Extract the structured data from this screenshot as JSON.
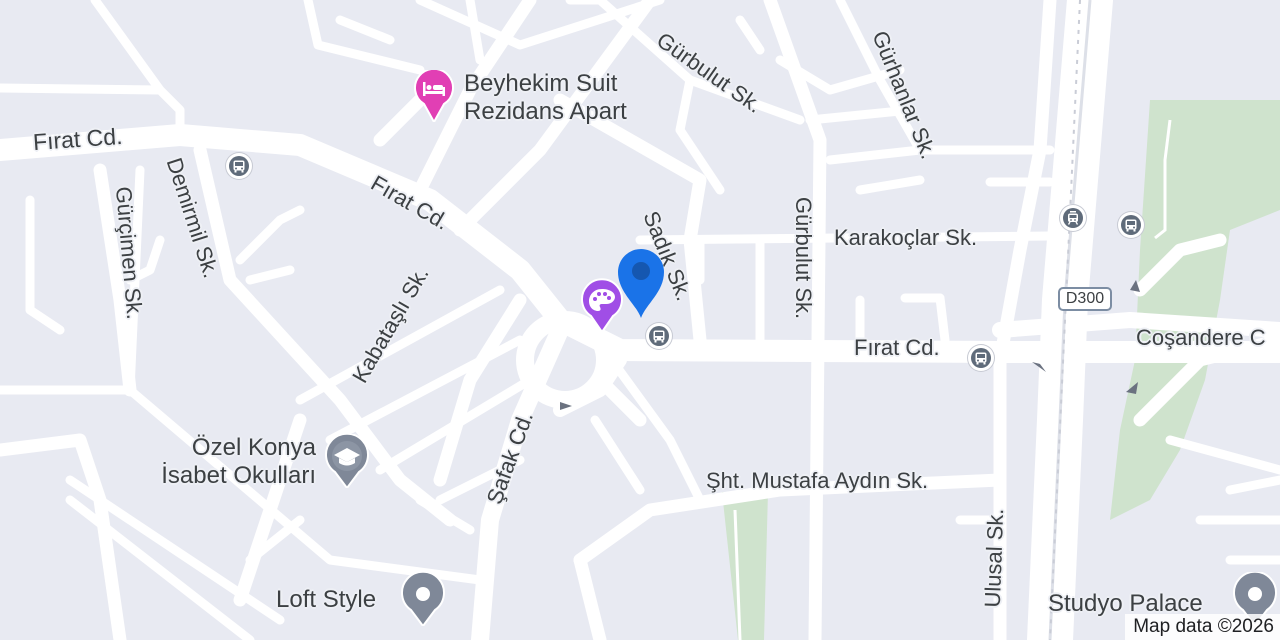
{
  "streets": {
    "firat_cd_west": "Fırat Cd.",
    "firat_cd_middle": "Fırat Cd.",
    "firat_cd_east": "Fırat Cd.",
    "gurbulut_sk_top": "Gürbulut Sk.",
    "gurbulut_sk_mid": "Gürbulut Sk.",
    "gurhanlar_sk": "Gürhanlar Sk.",
    "karakoclar_sk": "Karakoçlar Sk.",
    "sadik_sk": "Sadık Sk.",
    "gurcimen_sk": "Gürçimen Sk.",
    "demirmil_sk": "Demirmil Sk.",
    "kabatasli_sk": "Kabataşlı Sk.",
    "safak_cd": "Şafak Cd.",
    "sht_mustafa_aydin_sk": "Şht. Mustafa Aydın Sk.",
    "ulusal_sk": "Ulusal Sk.",
    "cosandere": "Coşandere C"
  },
  "route_shield": "D300",
  "places": {
    "hotel": {
      "name_line1": "Beyhekim Suit",
      "name_line2": "Rezidans Apart",
      "icon": "hotel-bed-icon",
      "color": "#e13fb4"
    },
    "school": {
      "name_line1": "Özel Konya",
      "name_line2": "İsabet Okulları",
      "icon": "graduation-cap-icon",
      "color": "#7f8898"
    },
    "loft": {
      "name": "Loft Style",
      "icon": "place-dot-icon",
      "color": "#7f8898"
    },
    "studyo": {
      "name": "Studyo Palace",
      "icon": "place-dot-icon",
      "color": "#7f8898"
    },
    "art": {
      "icon": "palette-icon",
      "color": "#a04ee6"
    },
    "location_pin": {
      "icon": "location-pin-icon",
      "color": "#1a73e8"
    }
  },
  "transit": {
    "bus_icon": "bus-stop-icon",
    "tram_icon": "tram-stop-icon"
  },
  "attribution": "Map data ©2026",
  "colors": {
    "background": "#e8eaf2",
    "road": "#ffffff",
    "park": "#cfe3cd"
  }
}
